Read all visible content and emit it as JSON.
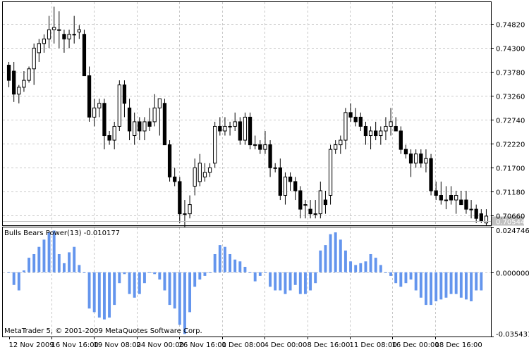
{
  "chart_data": [
    {
      "type": "candlestick",
      "ylim": [
        0.7045,
        0.753
      ],
      "ytick_labels": [
        "0.74820",
        "0.74300",
        "0.73780",
        "0.73260",
        "0.72740",
        "0.72220",
        "0.71700",
        "0.71180",
        "0.70660"
      ],
      "current_price_label": "0.70544",
      "grid": true,
      "candles": [
        {
          "o": 0.7393,
          "h": 0.74,
          "l": 0.7345,
          "c": 0.736
        },
        {
          "o": 0.738,
          "h": 0.74,
          "l": 0.7313,
          "c": 0.733
        },
        {
          "o": 0.733,
          "h": 0.735,
          "l": 0.731,
          "c": 0.7345
        },
        {
          "o": 0.7345,
          "h": 0.738,
          "l": 0.7335,
          "c": 0.736
        },
        {
          "o": 0.736,
          "h": 0.739,
          "l": 0.7355,
          "c": 0.7385
        },
        {
          "o": 0.7385,
          "h": 0.744,
          "l": 0.735,
          "c": 0.743
        },
        {
          "o": 0.742,
          "h": 0.745,
          "l": 0.74,
          "c": 0.744
        },
        {
          "o": 0.744,
          "h": 0.746,
          "l": 0.742,
          "c": 0.745
        },
        {
          "o": 0.745,
          "h": 0.75,
          "l": 0.743,
          "c": 0.747
        },
        {
          "o": 0.747,
          "h": 0.752,
          "l": 0.744,
          "c": 0.7475
        },
        {
          "o": 0.747,
          "h": 0.751,
          "l": 0.743,
          "c": 0.747
        },
        {
          "o": 0.746,
          "h": 0.747,
          "l": 0.742,
          "c": 0.745
        },
        {
          "o": 0.745,
          "h": 0.747,
          "l": 0.743,
          "c": 0.746
        },
        {
          "o": 0.746,
          "h": 0.75,
          "l": 0.744,
          "c": 0.746
        },
        {
          "o": 0.7465,
          "h": 0.748,
          "l": 0.745,
          "c": 0.747
        },
        {
          "o": 0.746,
          "h": 0.747,
          "l": 0.742,
          "c": 0.737
        },
        {
          "o": 0.737,
          "h": 0.739,
          "l": 0.727,
          "c": 0.728
        },
        {
          "o": 0.728,
          "h": 0.732,
          "l": 0.726,
          "c": 0.73
        },
        {
          "o": 0.73,
          "h": 0.732,
          "l": 0.728,
          "c": 0.731
        },
        {
          "o": 0.731,
          "h": 0.732,
          "l": 0.721,
          "c": 0.724
        },
        {
          "o": 0.724,
          "h": 0.725,
          "l": 0.722,
          "c": 0.723
        },
        {
          "o": 0.723,
          "h": 0.727,
          "l": 0.721,
          "c": 0.726
        },
        {
          "o": 0.726,
          "h": 0.736,
          "l": 0.725,
          "c": 0.735
        },
        {
          "o": 0.735,
          "h": 0.736,
          "l": 0.728,
          "c": 0.731
        },
        {
          "o": 0.73,
          "h": 0.732,
          "l": 0.723,
          "c": 0.725
        },
        {
          "o": 0.724,
          "h": 0.729,
          "l": 0.722,
          "c": 0.727
        },
        {
          "o": 0.727,
          "h": 0.728,
          "l": 0.723,
          "c": 0.725
        },
        {
          "o": 0.725,
          "h": 0.728,
          "l": 0.723,
          "c": 0.727
        },
        {
          "o": 0.727,
          "h": 0.73,
          "l": 0.725,
          "c": 0.726
        },
        {
          "o": 0.727,
          "h": 0.733,
          "l": 0.726,
          "c": 0.73
        },
        {
          "o": 0.73,
          "h": 0.732,
          "l": 0.724,
          "c": 0.732
        },
        {
          "o": 0.731,
          "h": 0.732,
          "l": 0.723,
          "c": 0.722
        },
        {
          "o": 0.722,
          "h": 0.723,
          "l": 0.714,
          "c": 0.715
        },
        {
          "o": 0.715,
          "h": 0.717,
          "l": 0.713,
          "c": 0.714
        },
        {
          "o": 0.714,
          "h": 0.715,
          "l": 0.705,
          "c": 0.707
        },
        {
          "o": 0.707,
          "h": 0.71,
          "l": 0.704,
          "c": 0.707
        },
        {
          "o": 0.707,
          "h": 0.711,
          "l": 0.706,
          "c": 0.709
        },
        {
          "o": 0.713,
          "h": 0.719,
          "l": 0.711,
          "c": 0.717
        },
        {
          "o": 0.714,
          "h": 0.72,
          "l": 0.713,
          "c": 0.718
        },
        {
          "o": 0.715,
          "h": 0.718,
          "l": 0.714,
          "c": 0.716
        },
        {
          "o": 0.716,
          "h": 0.718,
          "l": 0.715,
          "c": 0.717
        },
        {
          "o": 0.718,
          "h": 0.727,
          "l": 0.717,
          "c": 0.726
        },
        {
          "o": 0.726,
          "h": 0.728,
          "l": 0.724,
          "c": 0.725
        },
        {
          "o": 0.725,
          "h": 0.728,
          "l": 0.724,
          "c": 0.726
        },
        {
          "o": 0.726,
          "h": 0.727,
          "l": 0.724,
          "c": 0.726
        },
        {
          "o": 0.726,
          "h": 0.729,
          "l": 0.725,
          "c": 0.727
        },
        {
          "o": 0.727,
          "h": 0.728,
          "l": 0.722,
          "c": 0.723
        },
        {
          "o": 0.723,
          "h": 0.729,
          "l": 0.722,
          "c": 0.728
        },
        {
          "o": 0.728,
          "h": 0.729,
          "l": 0.721,
          "c": 0.722
        },
        {
          "o": 0.722,
          "h": 0.724,
          "l": 0.721,
          "c": 0.722
        },
        {
          "o": 0.722,
          "h": 0.723,
          "l": 0.72,
          "c": 0.721
        },
        {
          "o": 0.721,
          "h": 0.725,
          "l": 0.72,
          "c": 0.722
        },
        {
          "o": 0.722,
          "h": 0.723,
          "l": 0.715,
          "c": 0.717
        },
        {
          "o": 0.717,
          "h": 0.718,
          "l": 0.716,
          "c": 0.717
        },
        {
          "o": 0.717,
          "h": 0.719,
          "l": 0.71,
          "c": 0.711
        },
        {
          "o": 0.711,
          "h": 0.716,
          "l": 0.709,
          "c": 0.715
        },
        {
          "o": 0.715,
          "h": 0.716,
          "l": 0.712,
          "c": 0.714
        },
        {
          "o": 0.714,
          "h": 0.715,
          "l": 0.71,
          "c": 0.712
        },
        {
          "o": 0.712,
          "h": 0.713,
          "l": 0.706,
          "c": 0.708
        },
        {
          "o": 0.709,
          "h": 0.71,
          "l": 0.706,
          "c": 0.709
        },
        {
          "o": 0.708,
          "h": 0.71,
          "l": 0.706,
          "c": 0.707
        },
        {
          "o": 0.707,
          "h": 0.71,
          "l": 0.706,
          "c": 0.707
        },
        {
          "o": 0.707,
          "h": 0.714,
          "l": 0.706,
          "c": 0.712
        },
        {
          "o": 0.71,
          "h": 0.712,
          "l": 0.707,
          "c": 0.709
        },
        {
          "o": 0.711,
          "h": 0.722,
          "l": 0.709,
          "c": 0.721
        },
        {
          "o": 0.721,
          "h": 0.723,
          "l": 0.72,
          "c": 0.722
        },
        {
          "o": 0.722,
          "h": 0.724,
          "l": 0.72,
          "c": 0.723
        },
        {
          "o": 0.723,
          "h": 0.73,
          "l": 0.721,
          "c": 0.729
        },
        {
          "o": 0.729,
          "h": 0.731,
          "l": 0.727,
          "c": 0.728
        },
        {
          "o": 0.728,
          "h": 0.73,
          "l": 0.726,
          "c": 0.727
        },
        {
          "o": 0.728,
          "h": 0.729,
          "l": 0.725,
          "c": 0.726
        },
        {
          "o": 0.726,
          "h": 0.727,
          "l": 0.722,
          "c": 0.724
        },
        {
          "o": 0.724,
          "h": 0.726,
          "l": 0.721,
          "c": 0.725
        },
        {
          "o": 0.725,
          "h": 0.727,
          "l": 0.723,
          "c": 0.724
        },
        {
          "o": 0.724,
          "h": 0.726,
          "l": 0.722,
          "c": 0.725
        },
        {
          "o": 0.725,
          "h": 0.728,
          "l": 0.723,
          "c": 0.726
        },
        {
          "o": 0.726,
          "h": 0.73,
          "l": 0.724,
          "c": 0.727
        },
        {
          "o": 0.726,
          "h": 0.728,
          "l": 0.725,
          "c": 0.725
        },
        {
          "o": 0.725,
          "h": 0.726,
          "l": 0.72,
          "c": 0.721
        },
        {
          "o": 0.721,
          "h": 0.722,
          "l": 0.719,
          "c": 0.72
        },
        {
          "o": 0.72,
          "h": 0.721,
          "l": 0.715,
          "c": 0.718
        },
        {
          "o": 0.718,
          "h": 0.721,
          "l": 0.717,
          "c": 0.72
        },
        {
          "o": 0.72,
          "h": 0.721,
          "l": 0.717,
          "c": 0.718
        },
        {
          "o": 0.718,
          "h": 0.721,
          "l": 0.716,
          "c": 0.719
        },
        {
          "o": 0.719,
          "h": 0.72,
          "l": 0.711,
          "c": 0.712
        },
        {
          "o": 0.712,
          "h": 0.714,
          "l": 0.71,
          "c": 0.711
        },
        {
          "o": 0.711,
          "h": 0.714,
          "l": 0.709,
          "c": 0.71
        },
        {
          "o": 0.71,
          "h": 0.713,
          "l": 0.708,
          "c": 0.71
        },
        {
          "o": 0.711,
          "h": 0.713,
          "l": 0.709,
          "c": 0.71
        },
        {
          "o": 0.71,
          "h": 0.712,
          "l": 0.707,
          "c": 0.711
        },
        {
          "o": 0.71,
          "h": 0.712,
          "l": 0.709,
          "c": 0.709
        },
        {
          "o": 0.71,
          "h": 0.712,
          "l": 0.707,
          "c": 0.708
        },
        {
          "o": 0.708,
          "h": 0.71,
          "l": 0.706,
          "c": 0.708
        },
        {
          "o": 0.708,
          "h": 0.709,
          "l": 0.705,
          "c": 0.706
        },
        {
          "o": 0.707,
          "h": 0.708,
          "l": 0.705,
          "c": 0.7055
        },
        {
          "o": 0.705,
          "h": 0.708,
          "l": 0.7045,
          "c": 0.7065
        }
      ]
    },
    {
      "type": "bar",
      "title": "Bulls Bears Power(13) -0.010177",
      "ylim": [
        -0.035431,
        0.024746
      ],
      "ytick_labels": [
        "0.024746",
        "0.000000",
        "-0.035431"
      ],
      "bar_color": "#6495ed",
      "values": [
        0.0,
        -0.007,
        -0.01,
        0.001,
        0.008,
        0.01,
        0.014,
        0.018,
        0.022,
        0.023,
        0.01,
        0.005,
        0.011,
        0.014,
        0.004,
        0.0,
        -0.02,
        -0.022,
        -0.025,
        -0.026,
        -0.025,
        -0.018,
        -0.006,
        -0.001,
        -0.012,
        -0.014,
        -0.012,
        -0.006,
        0.0,
        -0.001,
        -0.004,
        -0.01,
        -0.018,
        -0.02,
        -0.029,
        -0.034,
        -0.022,
        -0.008,
        -0.004,
        -0.002,
        0.0,
        0.01,
        0.015,
        0.014,
        0.01,
        0.007,
        0.006,
        0.003,
        0.0,
        -0.005,
        -0.002,
        0.0,
        -0.008,
        -0.01,
        -0.01,
        -0.012,
        -0.01,
        -0.007,
        -0.012,
        -0.012,
        -0.01,
        -0.006,
        0.012,
        0.015,
        0.021,
        0.022,
        0.018,
        0.012,
        0.006,
        0.004,
        0.005,
        0.006,
        0.01,
        0.008,
        0.004,
        0.0,
        -0.002,
        -0.006,
        -0.008,
        -0.006,
        -0.004,
        -0.01,
        -0.014,
        -0.018,
        -0.018,
        -0.016,
        -0.015,
        -0.014,
        -0.012,
        -0.012,
        -0.014,
        -0.015,
        -0.016,
        -0.01,
        -0.01
      ],
      "watermark": "MetaTrader 5, © 2001-2009 MetaQuotes Software Corp."
    }
  ],
  "x_axis_labels": [
    "12 Nov 2009",
    "16 Nov 16:00",
    "19 Nov 08:00",
    "24 Nov 00:00",
    "26 Nov 16:00",
    "1 Dec 08:00",
    "4 Dec 00:00",
    "8 Dec 16:00",
    "11 Dec 08:00",
    "16 Dec 00:00",
    "18 Dec 16:00"
  ],
  "colors": {
    "grid": "#c8c8c8",
    "candle_up_fill": "#ffffff",
    "candle_down_fill": "#000000",
    "candle_outline": "#000000",
    "price_line": "#c0c0c0",
    "price_label_bg": "#c0c0c0"
  }
}
